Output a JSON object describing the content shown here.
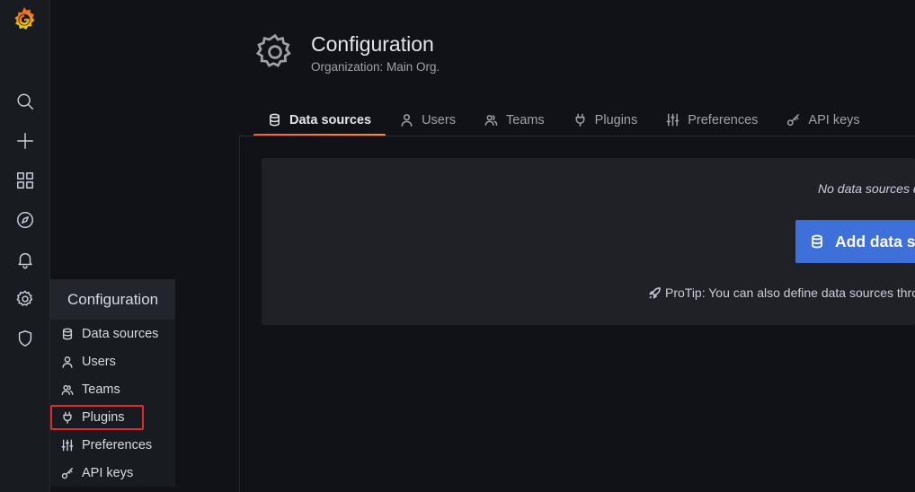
{
  "sidebar": {
    "logo": "grafana-logo",
    "icons": [
      "search-icon",
      "plus-icon",
      "dashboards-icon",
      "explore-icon",
      "alerting-icon",
      "configuration-icon",
      "shield-icon"
    ]
  },
  "flyout": {
    "title": "Configuration",
    "items": [
      {
        "label": "Data sources",
        "icon": "database-icon"
      },
      {
        "label": "Users",
        "icon": "user-icon"
      },
      {
        "label": "Teams",
        "icon": "users-icon"
      },
      {
        "label": "Plugins",
        "icon": "plug-icon"
      },
      {
        "label": "Preferences",
        "icon": "sliders-icon"
      },
      {
        "label": "API keys",
        "icon": "key-icon"
      }
    ],
    "highlight_color": "#e02b2b"
  },
  "header": {
    "title": "Configuration",
    "subtitle": "Organization: Main Org."
  },
  "tabs": [
    {
      "label": "Data sources",
      "icon": "database-icon",
      "active": true
    },
    {
      "label": "Users",
      "icon": "user-icon",
      "active": false
    },
    {
      "label": "Teams",
      "icon": "users-icon",
      "active": false
    },
    {
      "label": "Plugins",
      "icon": "plug-icon",
      "active": false
    },
    {
      "label": "Preferences",
      "icon": "sliders-icon",
      "active": false
    },
    {
      "label": "API keys",
      "icon": "key-icon",
      "active": false
    }
  ],
  "empty_state": {
    "message": "No data sources defined",
    "button_label": "Add data source",
    "protip": "ProTip: You can also define data sources through configuration files."
  },
  "colors": {
    "accent_gradient": [
      "#f55f3e",
      "#ff8833"
    ],
    "primary_button": "#3d71d9",
    "background": "#111217"
  }
}
